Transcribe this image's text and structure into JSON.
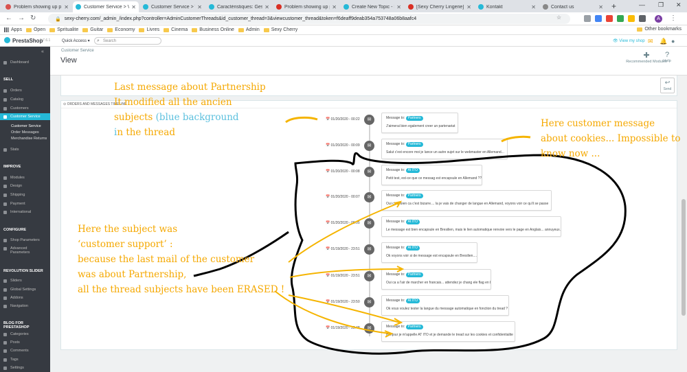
{
  "browser": {
    "tabs": [
      {
        "title": "Problem showing up p",
        "color": "#d9534f"
      },
      {
        "title": "Customer Service > Vi",
        "color": "#25b9d7",
        "active": true
      },
      {
        "title": "Customer Service > Vi",
        "color": "#25b9d7"
      },
      {
        "title": "Caractéristiques: Gest",
        "color": "#25b9d7"
      },
      {
        "title": "Problem showing up p",
        "color": "#d93025"
      },
      {
        "title": "Create New Topic - Pr",
        "color": "#25b9d7"
      },
      {
        "title": "[Sexy Cherry Lingerie]",
        "color": "#d93025"
      },
      {
        "title": "Kontakt",
        "color": "#25b9d7"
      },
      {
        "title": "Contact us",
        "color": "#888888"
      }
    ],
    "url": "sexy-cherry.com/_admin_/index.php?controller=AdminCustomerThreads&id_customer_thread=3&viewcustomer_thread&token=f6deaff9deab354a753748a06b8aafc4",
    "avatar_letter": "A",
    "bookmarks": [
      "Apps",
      "Open",
      "Spritualite",
      "Guitar",
      "Economy",
      "Livres",
      "Cinema",
      "Business Online",
      "Admin",
      "Sexy Cherry"
    ],
    "other_bookmarks": "Other bookmarks"
  },
  "ps": {
    "logo": "PrestaShop",
    "version": "1.7.6.1",
    "quick_access": "Quick Access ▾",
    "search_placeholder": "Search",
    "view_shop": "View my shop",
    "breadcrumb": "Customer Service",
    "title": "View",
    "recommended": "Recommended Modules",
    "help": "Help",
    "send": "Send",
    "timeline_title": "Orders and messages timeline"
  },
  "sidebar": {
    "dashboard": "Dashboard",
    "sell": "Sell",
    "orders": "Orders",
    "catalog": "Catalog",
    "customers": "Customers",
    "customer_service": "Customer Service",
    "sub_cs": "Customer Service",
    "sub_om": "Order Messages",
    "sub_mr": "Merchandise Returns",
    "stats": "Stats",
    "improve": "Improve",
    "modules": "Modules",
    "design": "Design",
    "shipping": "Shipping",
    "payment": "Payment",
    "international": "International",
    "configure": "Configure",
    "shop_params": "Shop Parameters",
    "advanced": "Advanced",
    "parameters": "Parameters",
    "revslider": "Revolution Slider",
    "sliders": "Sliders",
    "global": "Global Settings",
    "addons": "Addons",
    "navigation": "Navigation",
    "blog": "Blog for PrestaShop",
    "categories": "Categories",
    "posts": "Posts",
    "comments": "Comments",
    "tags": "Tags",
    "settings": "Settings"
  },
  "timeline": [
    {
      "date": "01/20/2020 - 00:22",
      "to": "Message to:",
      "badge": "Partners",
      "body": "J'aimerai bien egalement creer un partenariat"
    },
    {
      "date": "01/20/2020 - 00:09",
      "to": "Message to:",
      "badge": "Partners",
      "body": "Salut c'est encore moi je lance un autre sujet sur le webmaster en Allemand..."
    },
    {
      "date": "01/20/2020 - 00:08",
      "to": "Message to:",
      "badge": "At ITO",
      "body": "Petit test, est-ce que ce messag est encapsule en Allemand ???"
    },
    {
      "date": "01/20/2020 - 00:07",
      "to": "Message to:",
      "badge": "Partners",
      "body": "Oui c'est bien ca c'est bizarre.... la je vais de changer de langue en Allemand, voyons voir ce qu'il se passe"
    },
    {
      "date": "01/20/2020 - 00:05",
      "to": "Message to:",
      "badge": "At ITO",
      "body": "Le message est bien encapsule en Bresilien, mais le lien automatique renvoie vers le page en Anglais... annuyeux..."
    },
    {
      "date": "01/19/2020 - 23:51",
      "to": "Message to:",
      "badge": "At ITO",
      "body": "Ok voyons voir si de message est encapsule en Bresilien...."
    },
    {
      "date": "01/19/2020 - 23:51",
      "to": "Message to:",
      "badge": "Partners",
      "body": "Oui ca a l'air de marcher en francais... attendez je chang ele flag en bresilien"
    },
    {
      "date": "01/19/2020 - 23:50",
      "to": "Message to:",
      "badge": "At ITO",
      "body": "Ok vous voulez tester la langue du message automatique en fonction du tread ?"
    },
    {
      "date": "01/19/2020 - 23:48",
      "to": "Message to:",
      "badge": "Partners",
      "body": "Bonjour je m'appelle AT ITO et je demande le tread sur les cookies et confidentialite"
    }
  ],
  "annotations": {
    "note1": [
      "Last message about Partnership",
      "It modified all the ancien"
    ],
    "note1_pre": "subjects ",
    "note1_blue": "(blue background",
    "note1_post": "",
    "note1_i": "i",
    "note1_last": "n the thread",
    "note2": [
      "Here customer message",
      "about cookies... Impossible to",
      "know now ..."
    ],
    "note3": [
      "Here the subject was",
      "‘customer support’ :",
      "because the last mail of the customer",
      "was about Partnership,",
      "all the thread subjects have been ERASED !"
    ]
  },
  "colors": {
    "accent": "#25b9d7",
    "sidebar": "#363a41",
    "annotation": "#f5a800"
  }
}
